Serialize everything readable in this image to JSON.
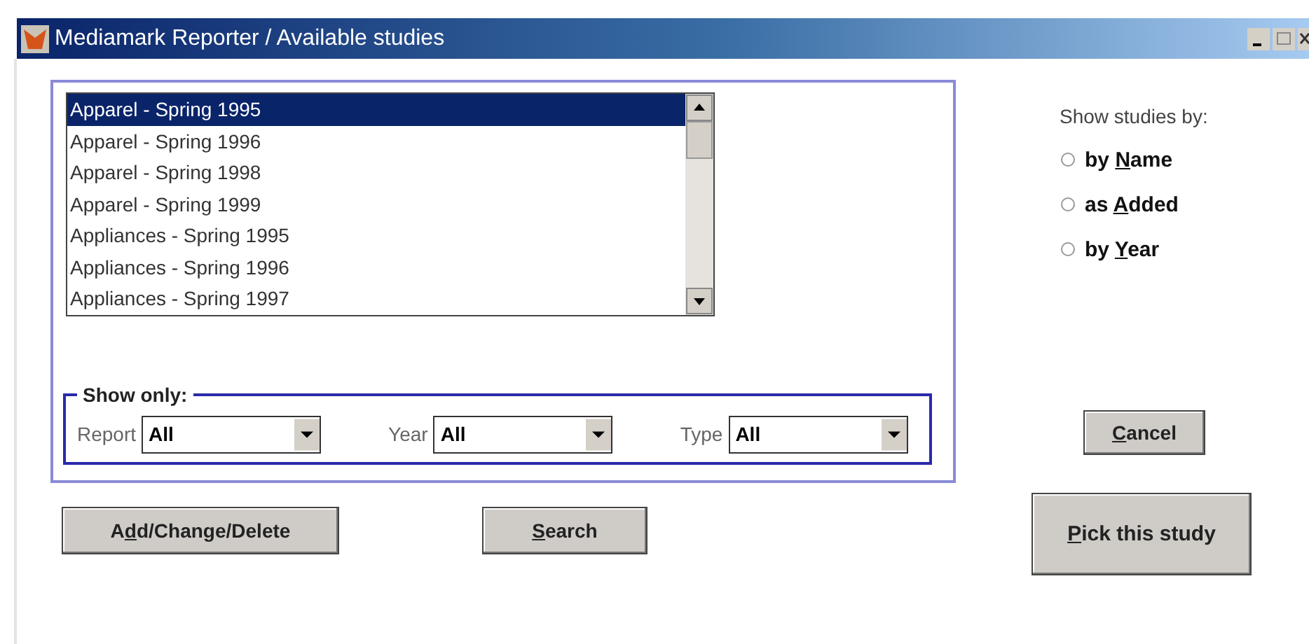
{
  "window": {
    "title": "Mediamark Reporter / Available studies"
  },
  "studies": [
    {
      "label": "Apparel - Spring 1995",
      "selected": true
    },
    {
      "label": "Apparel - Spring 1996",
      "selected": false
    },
    {
      "label": "Apparel - Spring 1998",
      "selected": false
    },
    {
      "label": "Apparel - Spring 1999",
      "selected": false
    },
    {
      "label": "Appliances - Spring 1995",
      "selected": false
    },
    {
      "label": "Appliances - Spring 1996",
      "selected": false
    },
    {
      "label": "Appliances - Spring 1997",
      "selected": false
    }
  ],
  "show_only": {
    "legend": "Show only:",
    "filters": [
      {
        "label": "Report",
        "value": "All"
      },
      {
        "label": "Year",
        "value": "All"
      },
      {
        "label": "Type",
        "value": "All"
      }
    ]
  },
  "sort": {
    "label": "Show studies by:",
    "options": [
      {
        "before": "by ",
        "key": "N",
        "after": "ame",
        "selected": false
      },
      {
        "before": "as ",
        "key": "A",
        "after": "dded",
        "selected": false
      },
      {
        "before": "by ",
        "key": "Y",
        "after": "ear",
        "selected": false
      }
    ]
  },
  "buttons": {
    "add": {
      "before": "A",
      "key": "d",
      "after": "d/Change/Delete"
    },
    "search": {
      "key": "S",
      "after": "earch"
    },
    "cancel": {
      "key": "C",
      "after": "ancel"
    },
    "pick": {
      "key": "P",
      "after": "ick this study"
    }
  }
}
